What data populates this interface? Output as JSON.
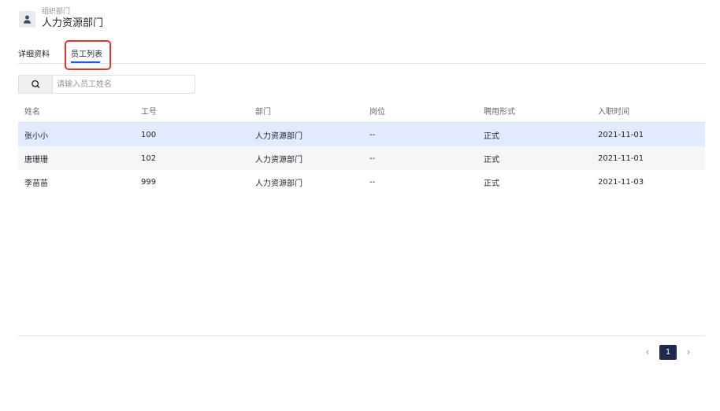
{
  "header": {
    "icon": "user-icon",
    "subtitle": "组织部门",
    "title": "人力资源部门"
  },
  "tabs": [
    {
      "label": "详细资料",
      "active": false
    },
    {
      "label": "员工列表",
      "active": true
    }
  ],
  "search": {
    "icon": "search-icon",
    "placeholder": "请输入员工姓名",
    "value": ""
  },
  "table": {
    "columns": [
      "姓名",
      "工号",
      "部门",
      "岗位",
      "聘用形式",
      "入职时间"
    ],
    "rows": [
      [
        "张小小",
        "100",
        "人力资源部门",
        "--",
        "正式",
        "2021-11-01"
      ],
      [
        "唐珊珊",
        "102",
        "人力资源部门",
        "--",
        "正式",
        "2021-11-01"
      ],
      [
        "李苗苗",
        "999",
        "人力资源部门",
        "--",
        "正式",
        "2021-11-03"
      ]
    ]
  },
  "pagination": {
    "prev": "‹",
    "current": "1",
    "next": "›"
  },
  "colors": {
    "accent": "#245bdb",
    "selected_row": "#e1eaff",
    "highlight_box": "#e5352b",
    "page_active": "#1f2b4d"
  }
}
